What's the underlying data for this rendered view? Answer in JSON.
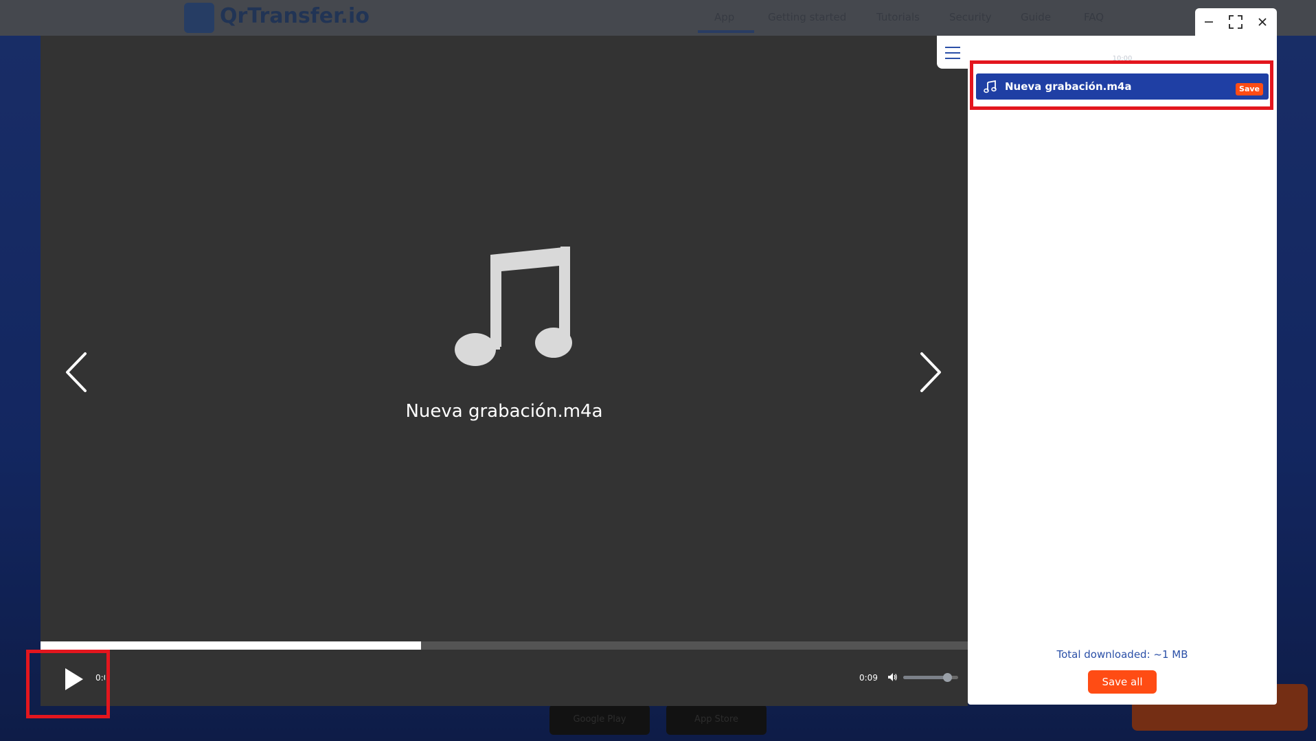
{
  "background_site": {
    "logo_text": "QrTransfer.io",
    "nav_items": [
      "App",
      "Getting started",
      "Tutorials",
      "Security",
      "Guide",
      "FAQ"
    ],
    "store_badges": [
      "Google Play",
      "App Store"
    ]
  },
  "viewer": {
    "file_name": "Nueva grabación.m4a",
    "progress": 0.41,
    "current_time": "0:00",
    "total_time": "0:09",
    "volume": 0.8
  },
  "panel": {
    "time_header": "10:00",
    "files": [
      {
        "name": "Nueva grabación.m4a",
        "save_label": "Save"
      }
    ],
    "total_downloaded": "Total downloaded: ~1 MB",
    "save_all_label": "Save all"
  },
  "colors": {
    "accent_blue": "#1f3fa4",
    "accent_orange": "#ff4c14",
    "viewer_bg": "#333333",
    "annotation_red": "#e3161e"
  },
  "icons": {
    "music_note": "music-note-icon",
    "menu": "hamburger-menu-icon",
    "play": "play-icon",
    "volume": "volume-icon"
  }
}
